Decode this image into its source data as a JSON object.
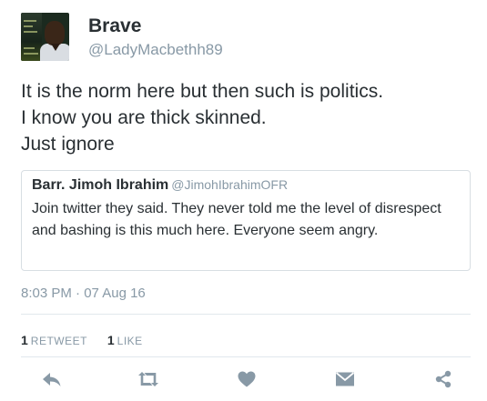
{
  "user": {
    "name": "Brave",
    "handle": "@LadyMacbethh89"
  },
  "tweet": {
    "lines": [
      "It is the norm here but then such is politics.",
      "I know you are thick skinned.",
      "Just ignore"
    ]
  },
  "quote": {
    "name": "Barr. Jimoh Ibrahim",
    "handle": "@JimohIbrahimOFR",
    "text": "Join twitter they said. They never told me the level of disrespect and bashing is this much here. Everyone seem angry."
  },
  "timestamp": "8:03 PM · 07 Aug 16",
  "stats": {
    "retweets": {
      "count": "1",
      "label": "RETWEET"
    },
    "likes": {
      "count": "1",
      "label": "LIKE"
    }
  },
  "actions": [
    {
      "name": "reply-icon"
    },
    {
      "name": "retweet-icon"
    },
    {
      "name": "heart-icon"
    },
    {
      "name": "message-icon"
    },
    {
      "name": "share-icon"
    }
  ],
  "colors": {
    "text": "#292f33",
    "muted": "#8899a6",
    "icon": "#8899a6",
    "border": "#e1e8ed"
  }
}
